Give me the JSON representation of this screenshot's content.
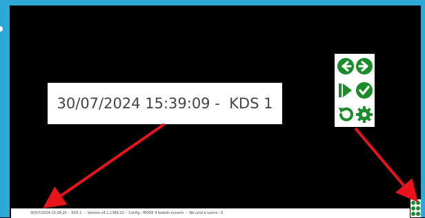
{
  "callout": {
    "text": "30/07/2024 15:39:09 -  KDS 1"
  },
  "status_bar": {
    "text": "30/07/2024 15:38:25 -  KDS 1  -  Version v4.1.1389.22 -  Config : MODE 4 boards ouverts  -  Nb cmd à suivre : 0"
  },
  "icons": [
    {
      "name": "arrow-left-icon"
    },
    {
      "name": "arrow-right-icon"
    },
    {
      "name": "skip-to-end-icon"
    },
    {
      "name": "check-circle-icon"
    },
    {
      "name": "undo-icon"
    },
    {
      "name": "gear-icon"
    }
  ],
  "colors": {
    "frame": "#2ea8d6",
    "icon_green": "#1a8c2a",
    "arrow_red": "#e8131b",
    "background": "#000000"
  }
}
